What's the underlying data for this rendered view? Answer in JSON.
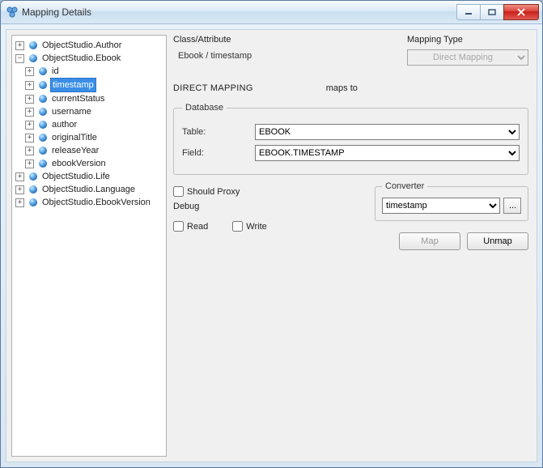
{
  "window": {
    "title": "Mapping Details"
  },
  "tree": {
    "roots": [
      {
        "label": "ObjectStudio.Author",
        "expanded": false
      },
      {
        "label": "ObjectStudio.Ebook",
        "expanded": true,
        "children": [
          {
            "label": "id"
          },
          {
            "label": "timestamp",
            "selected": true
          },
          {
            "label": "currentStatus"
          },
          {
            "label": "username"
          },
          {
            "label": "author"
          },
          {
            "label": "originalTitle"
          },
          {
            "label": "releaseYear"
          },
          {
            "label": "ebookVersion"
          }
        ]
      },
      {
        "label": "ObjectStudio.Life",
        "expanded": false
      },
      {
        "label": "ObjectStudio.Language",
        "expanded": false
      },
      {
        "label": "ObjectStudio.EbookVersion",
        "expanded": false
      }
    ]
  },
  "labels": {
    "class_attribute": "Class/Attribute",
    "mapping_type": "Mapping Type",
    "direct_mapping": "DIRECT MAPPING",
    "maps_to": "maps to",
    "database": "Database",
    "table": "Table:",
    "field": "Field:",
    "should_proxy": "Should Proxy",
    "debug": "Debug",
    "read": "Read",
    "write": "Write",
    "converter": "Converter",
    "map": "Map",
    "unmap": "Unmap",
    "ellipsis": "..."
  },
  "values": {
    "path": "Ebook / timestamp",
    "mapping_type_selected": "Direct Mapping",
    "table_selected": "EBOOK",
    "field_selected": "EBOOK.TIMESTAMP",
    "converter_selected": "timestamp",
    "should_proxy": false,
    "read": false,
    "write": false,
    "map_enabled": false,
    "unmap_enabled": true
  }
}
